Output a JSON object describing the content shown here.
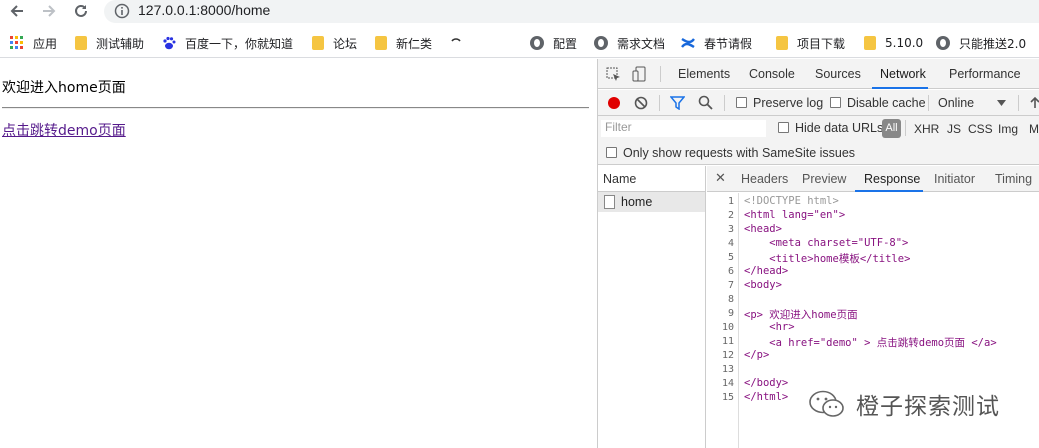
{
  "browser": {
    "url": "127.0.0.1:8000/home",
    "bookmarks": [
      "应用",
      "测试辅助",
      "百度一下，你就知道",
      "论坛",
      "新仁类",
      "配置",
      "需求文档",
      "春节请假",
      "项目下载",
      "5.10.0",
      "只能推送2.0"
    ]
  },
  "page": {
    "paragraph": "欢迎进入home页面",
    "link": "点击跳转demo页面"
  },
  "devtools": {
    "tabs": [
      "Elements",
      "Console",
      "Sources",
      "Network",
      "Performance"
    ],
    "active_tab": "Network",
    "toolbar": {
      "preserve_log": "Preserve log",
      "disable_cache": "Disable cache",
      "throttle": "Online"
    },
    "filter_placeholder": "Filter",
    "hide_data_urls": "Hide data URLs",
    "types": [
      "All",
      "XHR",
      "JS",
      "CSS",
      "Img",
      "M"
    ],
    "samesite": "Only show requests with SameSite issues",
    "name_header": "Name",
    "requests": [
      "home"
    ],
    "detail_tabs": [
      "Headers",
      "Preview",
      "Response",
      "Initiator",
      "Timing"
    ],
    "active_detail_tab": "Response",
    "line_numbers": [
      "1",
      "2",
      "3",
      "4",
      "5",
      "6",
      "7",
      "8",
      "9",
      "10",
      "11",
      "12",
      "13",
      "14",
      "15"
    ],
    "response_lines": [
      "<!DOCTYPE html>",
      "<html lang=\"en\">",
      "<head>",
      "    <meta charset=\"UTF-8\">",
      "    <title>home模板</title>",
      "</head>",
      "<body>",
      "",
      "<p> 欢迎进入home页面",
      "    <hr>",
      "    <a href=\"demo\" > 点击跳转demo页面 </a>",
      "</p>",
      "",
      "</body>",
      "</html>"
    ]
  },
  "watermark": "橙子探索测试",
  "colors": {
    "accent": "#1a73e8",
    "record": "#e00000",
    "link": "#551a8b",
    "folder": "#f5c542"
  }
}
